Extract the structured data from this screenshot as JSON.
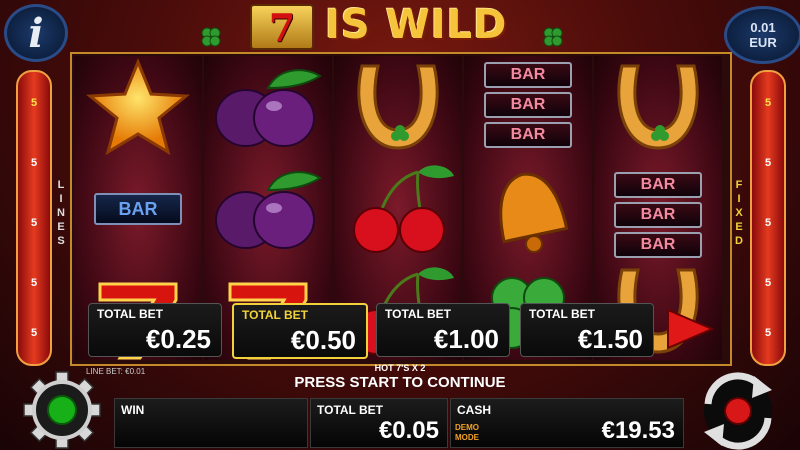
{
  "header": {
    "seven": "7",
    "title": "IS WILD"
  },
  "info": {
    "label": "i"
  },
  "denomination": {
    "amount": "0.01",
    "currency": "EUR"
  },
  "lines": {
    "left_word": "LINES",
    "right_word": "FIXED",
    "left_numbers": [
      "5",
      "5",
      "5",
      "5",
      "5"
    ],
    "right_numbers": [
      "5",
      "5",
      "5",
      "5",
      "5"
    ]
  },
  "reels": [
    [
      "star",
      "bar-single",
      "seven"
    ],
    [
      "plum",
      "plum",
      "seven"
    ],
    [
      "horseshoe",
      "cherry",
      "cherry"
    ],
    [
      "bar-triple",
      "bell",
      "clover"
    ],
    [
      "horseshoe",
      "bar-triple",
      "horseshoe"
    ]
  ],
  "bet_options": [
    {
      "label": "TOTAL BET",
      "value": "€0.25",
      "selected": false
    },
    {
      "label": "TOTAL BET",
      "value": "€0.50",
      "selected": true
    },
    {
      "label": "TOTAL BET",
      "value": "€1.00",
      "selected": false
    },
    {
      "label": "TOTAL BET",
      "value": "€1.50",
      "selected": false
    }
  ],
  "bar_text": "BAR",
  "status": {
    "hot_label": "HOT 7'S X 2",
    "line_bet": "LINE BET: €0.01",
    "message": "PRESS START TO CONTINUE"
  },
  "panels": {
    "win_label": "WIN",
    "win_value": "",
    "total_bet_label": "TOTAL BET",
    "total_bet_value": "€0.05",
    "cash_label": "CASH",
    "cash_value": "€19.53",
    "demo_line1": "DEMO",
    "demo_line2": "MODE"
  },
  "colors": {
    "accent": "#f1d23a",
    "demo": "#f2a22a",
    "play": "#e01818"
  },
  "icons": [
    "info-icon",
    "settings-gear-icon",
    "play-triangle-icon",
    "spin-arrows-icon",
    "clover-icon"
  ]
}
